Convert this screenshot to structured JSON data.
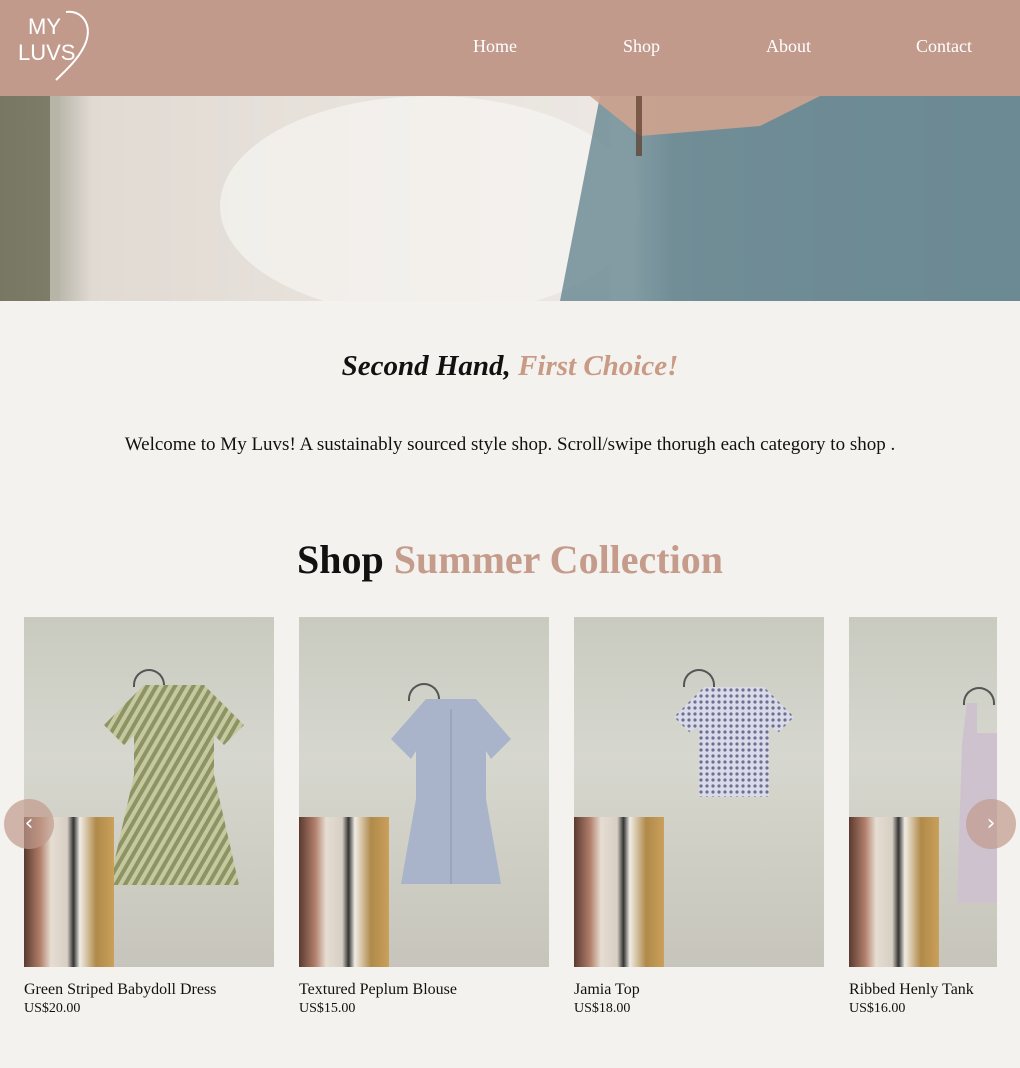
{
  "brand": {
    "logo_text_line1": "MY",
    "logo_text_line2": "LUVS"
  },
  "nav": {
    "items": [
      "Home",
      "Shop",
      "About",
      "Contact"
    ]
  },
  "tagline": {
    "part1": "Second Hand, ",
    "part2": "First Choice!"
  },
  "intro": "Welcome to My Luvs! A sustainably sourced style shop. Scroll/swipe thorugh each category to shop .",
  "section": {
    "title_part1": "Shop ",
    "title_part2": "Summer Collection"
  },
  "products": [
    {
      "name": "Green Striped Babydoll Dress",
      "price": "US$20.00"
    },
    {
      "name": "Textured Peplum Blouse",
      "price": "US$15.00"
    },
    {
      "name": "Jamia Top",
      "price": "US$18.00"
    },
    {
      "name": "Ribbed Henly Tank",
      "price": "US$16.00"
    }
  ],
  "carousel": {
    "prev_icon": "chevron-left-icon",
    "next_icon": "chevron-right-icon"
  },
  "colors": {
    "header_bg": "#c19a8c",
    "accent": "#c99a85",
    "page_bg": "#f4f2ee"
  }
}
